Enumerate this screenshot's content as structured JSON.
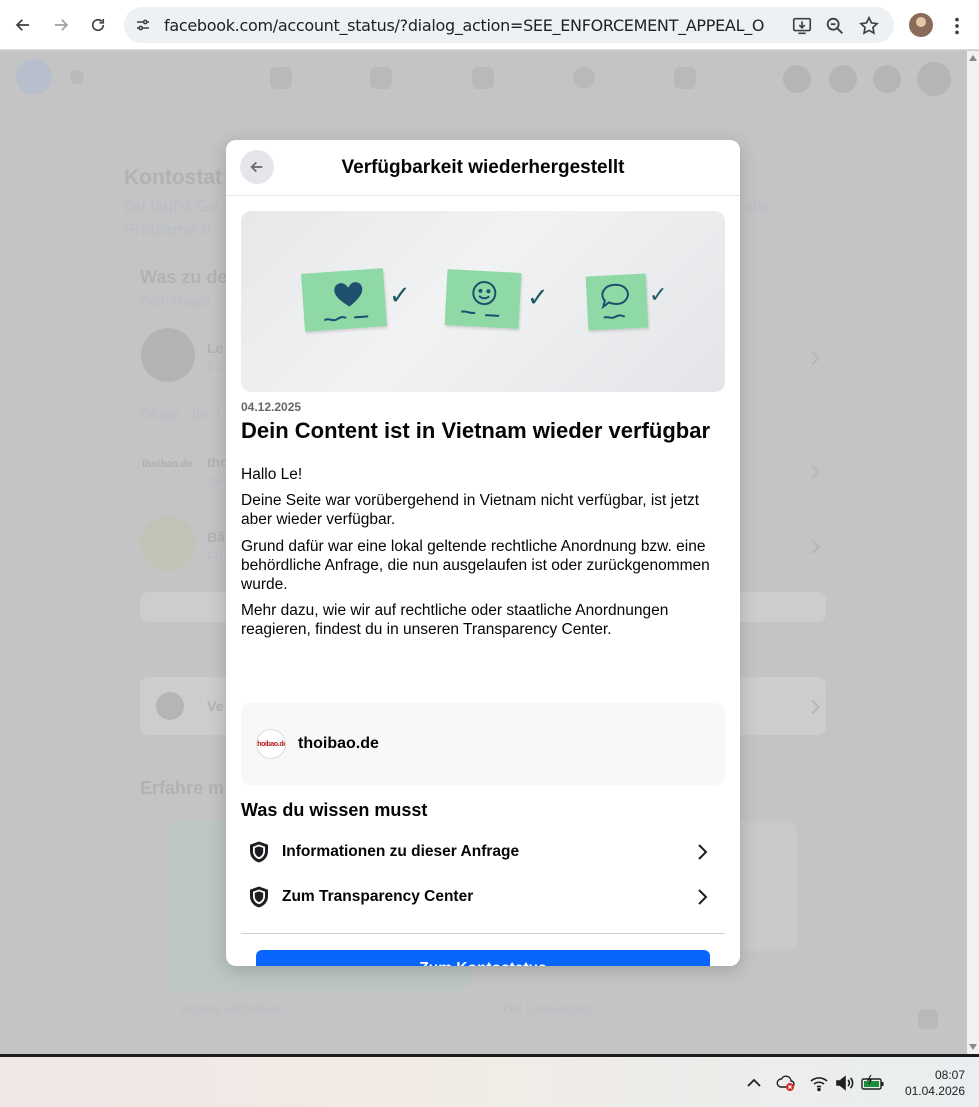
{
  "browser": {
    "url": "facebook.com/account_status/?dialog_action=SEE_ENFORCEMENT_APPEAL_OUTCOME&actio...",
    "icons": [
      "back-arrow-icon",
      "forward-arrow-icon",
      "reload-icon",
      "site-settings-icon",
      "install-icon",
      "zoom-icon",
      "bookmark-star-icon",
      "profile-avatar",
      "more-menu-icon"
    ]
  },
  "background": {
    "title_fragment": "Kontostat",
    "subtitle_line1": "Du läufst Ge",
    "subtitle_line1_right": "alle",
    "subtitle_line2": "Probleme b",
    "section_fragment": "Was zu de",
    "section_sub_fragment": "Dein Haupt",
    "row1_a": "Le",
    "row1_b": "Fü",
    "things_fragment": "Dinge, die d",
    "row2_logo": "thoibao.de",
    "row2_a": "tho",
    "row2_b": "Se",
    "row3_a": "Bầ",
    "row3_b": "Fü",
    "row4_a": "Ve",
    "learn_fragment": "Erfahre m",
    "caption_left": "Unsere Richtlinien",
    "caption_right": "Die Umsetzung"
  },
  "modal": {
    "title": "Verfügbarkeit wiederhergestellt",
    "date": "04.12.2025",
    "content_title": "Dein Content ist in Vietnam wieder verfügbar",
    "paragraphs": [
      "Hallo Le!",
      "Deine Seite war vorübergehend in Vietnam nicht verfügbar, ist jetzt aber wieder verfügbar.",
      "Grund dafür war eine lokal geltende rechtliche Anordnung bzw. eine behördliche Anfrage, die nun ausgelaufen ist oder zurückgenommen wurde.",
      "Mehr dazu, wie wir auf rechtliche oder staatliche Anordnungen reagieren, findest du in unseren Transparency Center."
    ],
    "page": {
      "logo_text": "thoibao.de",
      "name": "thoibao.de"
    },
    "section_title": "Was du wissen musst",
    "links": [
      {
        "label": "Informationen zu dieser Anfrage",
        "icon": "shield-icon"
      },
      {
        "label": "Zum Transparency Center",
        "icon": "shield-icon"
      }
    ],
    "button": "Zum Kontostatus",
    "accent_color": "#0866ff",
    "hero_checks": [
      "✓",
      "✓",
      "✓"
    ]
  },
  "taskbar": {
    "time": "08:07",
    "date": "01.04.2026",
    "tray_icons": [
      "chevron-up-icon",
      "cloud-error-icon",
      "wifi-icon",
      "volume-icon",
      "battery-icon"
    ]
  }
}
